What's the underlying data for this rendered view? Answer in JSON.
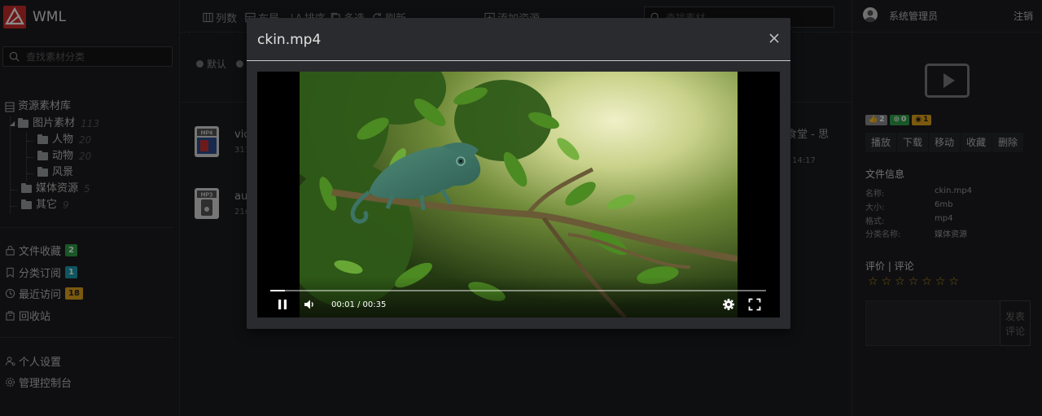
{
  "app": {
    "title": "WML"
  },
  "left": {
    "search_placeholder": "查找素材分类",
    "tree": [
      {
        "label": "资源素材库",
        "count": ""
      },
      {
        "label": "图片素材",
        "count": "113"
      },
      {
        "label": "人物",
        "count": "20"
      },
      {
        "label": "动物",
        "count": "20"
      },
      {
        "label": "风景",
        "count": ""
      },
      {
        "label": "媒体资源",
        "count": "5"
      },
      {
        "label": "其它",
        "count": "9"
      }
    ],
    "nav": [
      {
        "label": "文件收藏",
        "badge": "2",
        "color": "#2e9e48"
      },
      {
        "label": "分类订阅",
        "badge": "1",
        "color": "#1a9bb0"
      },
      {
        "label": "最近访问",
        "badge": "18",
        "color": "#e0a51c"
      },
      {
        "label": "回收站",
        "badge": ""
      }
    ],
    "settings": [
      {
        "label": "个人设置"
      },
      {
        "label": "管理控制台"
      }
    ]
  },
  "toolbar": {
    "columns": "列数",
    "layout": "布局",
    "sort": "排序",
    "multi": "多选",
    "refresh": "刷新",
    "add": "添加资源",
    "search_placeholder": "查找素材"
  },
  "sort": {
    "default": "默认"
  },
  "files": [
    {
      "name": "vic",
      "sub": "311",
      "icon_label": "MP4",
      "right": "食堂 - 思",
      "time": "14:17"
    },
    {
      "name": "au",
      "sub": "21n",
      "icon_label": "MP3",
      "right": "",
      "time": ""
    }
  ],
  "right": {
    "user": "系统管理员",
    "logout": "注销",
    "stats": [
      {
        "value": "2",
        "icon": "thumb-icon",
        "bg": "#8a8b8e",
        "fg": "#fff"
      },
      {
        "value": "0",
        "icon": "check-icon",
        "bg": "#2e9e48",
        "fg": "#fff"
      },
      {
        "value": "1",
        "icon": "eye-icon",
        "bg": "#e0a51c",
        "fg": "#222"
      }
    ],
    "actions": [
      "播放",
      "下载",
      "移动",
      "收藏",
      "删除"
    ],
    "info_title": "文件信息",
    "info": [
      {
        "k": "名称:",
        "v": "ckin.mp4"
      },
      {
        "k": "大小:",
        "v": "6mb"
      },
      {
        "k": "格式:",
        "v": "mp4"
      },
      {
        "k": "分类名称:",
        "v": "媒体资源"
      }
    ],
    "review_title": "评价 | 评论",
    "post_label_1": "发表",
    "post_label_2": "评论"
  },
  "modal": {
    "title": "ckin.mp4",
    "time": "00:01 / 00:35",
    "progress": 0.029
  }
}
